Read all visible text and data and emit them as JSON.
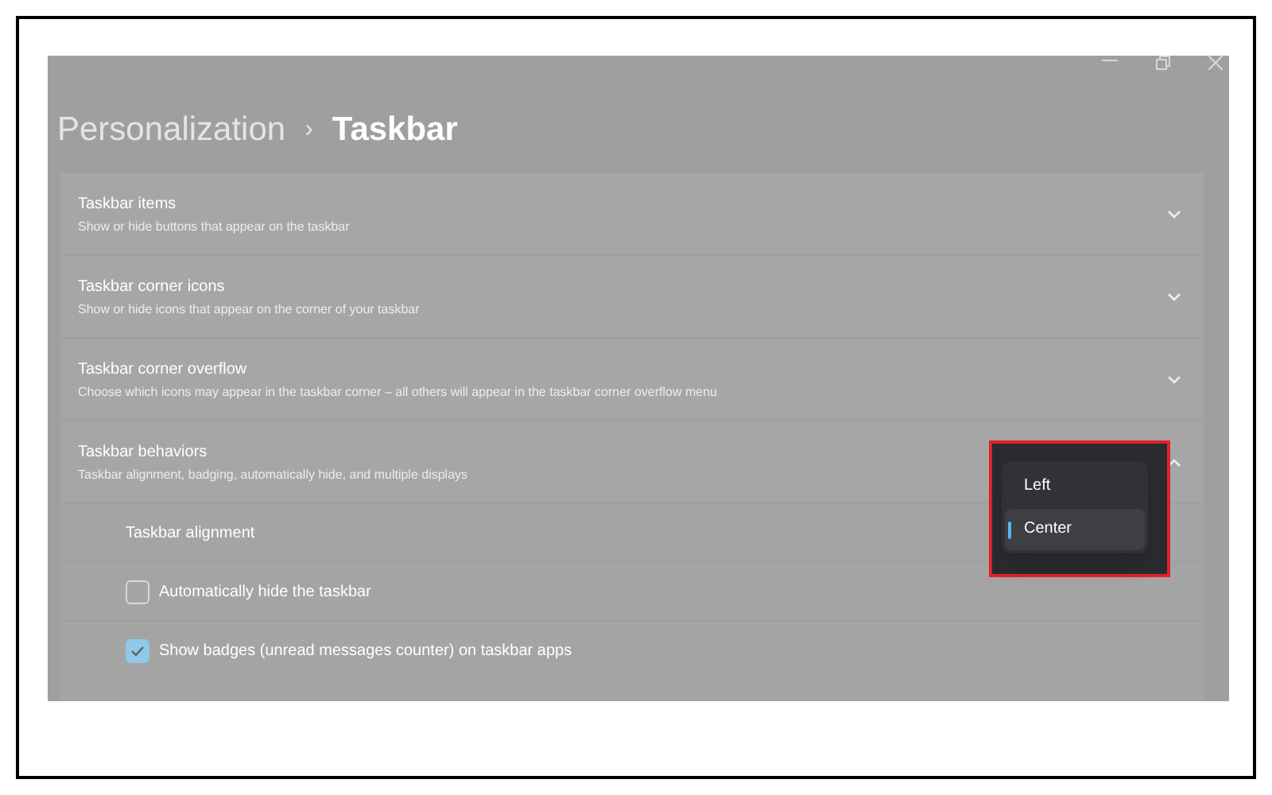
{
  "breadcrumb": {
    "parent": "Personalization",
    "separator": "›",
    "current": "Taskbar"
  },
  "sections": [
    {
      "title": "Taskbar items",
      "description": "Show or hide buttons that appear on the taskbar",
      "expanded": false
    },
    {
      "title": "Taskbar corner icons",
      "description": "Show or hide icons that appear on the corner of your taskbar",
      "expanded": false
    },
    {
      "title": "Taskbar corner overflow",
      "description": "Choose which icons may appear in the taskbar corner – all others will appear in the taskbar corner overflow menu",
      "expanded": false
    },
    {
      "title": "Taskbar behaviors",
      "description": "Taskbar alignment, badging, automatically hide, and multiple displays",
      "expanded": true
    }
  ],
  "behavior_rows": [
    {
      "kind": "dropdown",
      "label": "Taskbar alignment"
    },
    {
      "kind": "checkbox",
      "label": "Automatically hide the taskbar",
      "checked": false
    },
    {
      "kind": "checkbox",
      "label": "Show badges (unread messages counter) on taskbar apps",
      "checked": true
    }
  ],
  "alignment_menu": [
    {
      "label": "Left",
      "selected": false
    },
    {
      "label": "Center",
      "selected": true
    }
  ]
}
